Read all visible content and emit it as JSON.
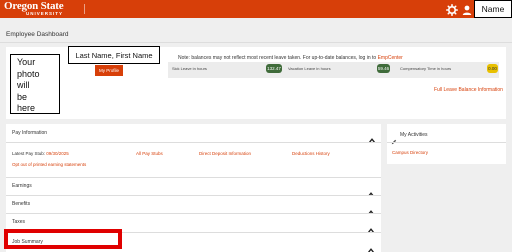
{
  "topbar": {
    "logo_title": "Oregon State",
    "logo_sub": "UNIVERSITY",
    "user_name": "Name",
    "settings_icon": "gear-icon",
    "user_icon": "user-icon",
    "brand_color": "#d73f09"
  },
  "dashboard": {
    "title": "Employee Dashboard"
  },
  "profile": {
    "photo_lines": [
      "Your",
      "photo",
      "will",
      "be",
      "here"
    ],
    "name": "Last Name, First Name",
    "my_profile_label": "My Profile"
  },
  "balances": {
    "note_prefix": "Note: balances may not reflect most recent leave taken. For up-to-date balances, log in to ",
    "note_link": "EmpCenter",
    "items": [
      {
        "label": "Sick Leave in hours",
        "value": "132.47",
        "color": "#3f6b3a"
      },
      {
        "label": "Vacation Leave in hours",
        "value": "59.46",
        "color": "#3f6b3a"
      },
      {
        "label": "Compensatory Time in hours",
        "value": "0.00",
        "color": "#e8c000"
      }
    ],
    "full_link": "Full Leave Balance Information"
  },
  "pay": {
    "header": "Pay Information",
    "latest_label": "Latest Pay Stub: ",
    "latest_date": "09/30/2025",
    "links": [
      "All Pay Stubs",
      "Direct Deposit Information",
      "Deductions History"
    ],
    "opt_out": "Opt out of printed earning statements"
  },
  "sections": [
    "Earnings",
    "Benefits",
    "Taxes",
    "Job Summary"
  ],
  "activities": {
    "header": "My Activities",
    "link": "Campus Directory"
  }
}
